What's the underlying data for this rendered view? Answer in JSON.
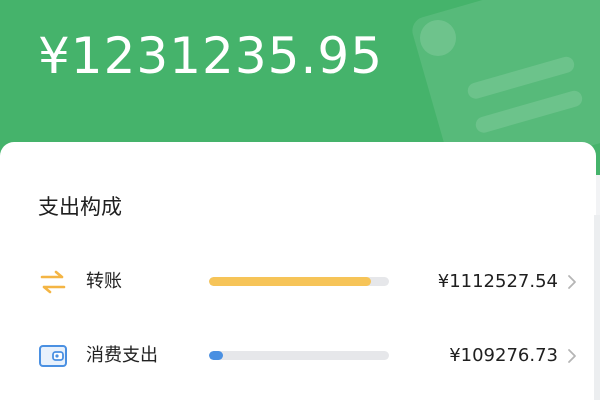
{
  "header": {
    "total_amount": "¥1231235.95",
    "background_color": "#45b36b"
  },
  "breakdown": {
    "title": "支出构成",
    "items": [
      {
        "label": "转账",
        "icon": "transfer-arrows-icon",
        "amount": "¥1112527.54",
        "progress": 0.9,
        "bar_color": "#f6c458"
      },
      {
        "label": "消费支出",
        "icon": "wallet-icon",
        "amount": "¥109276.73",
        "progress": 0.08,
        "bar_color": "#4a90e2"
      }
    ]
  }
}
